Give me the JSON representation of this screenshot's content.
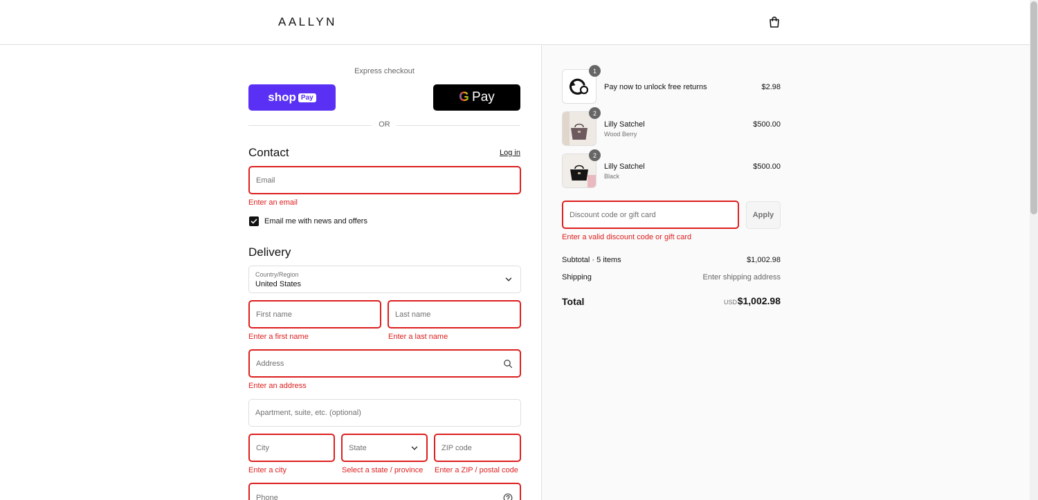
{
  "header": {
    "brand": "AALLYN",
    "cart_icon": "shopping-bag-icon"
  },
  "express": {
    "label": "Express checkout",
    "shop_pay_text": "shop",
    "shop_pay_badge": "Pay",
    "gpay_g": "G",
    "gpay_text": "Pay",
    "or_label": "OR"
  },
  "contact": {
    "title": "Contact",
    "login_label": "Log in",
    "email_placeholder": "Email",
    "email_error": "Enter an email",
    "newsletter_label": "Email me with news and offers",
    "newsletter_checked": true
  },
  "delivery": {
    "title": "Delivery",
    "country_label": "Country/Region",
    "country_value": "United States",
    "first_name_placeholder": "First name",
    "first_name_error": "Enter a first name",
    "last_name_placeholder": "Last name",
    "last_name_error": "Enter a last name",
    "address_placeholder": "Address",
    "address_error": "Enter an address",
    "apartment_placeholder": "Apartment, suite, etc. (optional)",
    "city_placeholder": "City",
    "city_error": "Enter a city",
    "state_placeholder": "State",
    "state_error": "Select a state / province",
    "zip_placeholder": "ZIP code",
    "zip_error": "Enter a ZIP / postal code",
    "phone_placeholder": "Phone"
  },
  "cart": {
    "items": [
      {
        "qty": "1",
        "name": "Pay now to unlock free returns",
        "variant": "",
        "price": "$2.98",
        "thumb_icon": "returns-icon"
      },
      {
        "qty": "2",
        "name": "Lilly Satchel",
        "variant": "Wood Berry",
        "price": "$500.00",
        "thumb_icon": "satchel-brown-image"
      },
      {
        "qty": "2",
        "name": "Lilly Satchel",
        "variant": "Black",
        "price": "$500.00",
        "thumb_icon": "satchel-black-image"
      }
    ],
    "discount_placeholder": "Discount code or gift card",
    "discount_error": "Enter a valid discount code or gift card",
    "apply_label": "Apply",
    "subtotal_label": "Subtotal · 5 items",
    "subtotal_value": "$1,002.98",
    "shipping_label": "Shipping",
    "shipping_value": "Enter shipping address",
    "total_label": "Total",
    "total_currency": "USD",
    "total_value": "$1,002.98"
  },
  "colors": {
    "error": "#dd1d1d",
    "shop_pay": "#5a31f4",
    "gpay": "#000000",
    "panel_bg": "#fafafa"
  }
}
